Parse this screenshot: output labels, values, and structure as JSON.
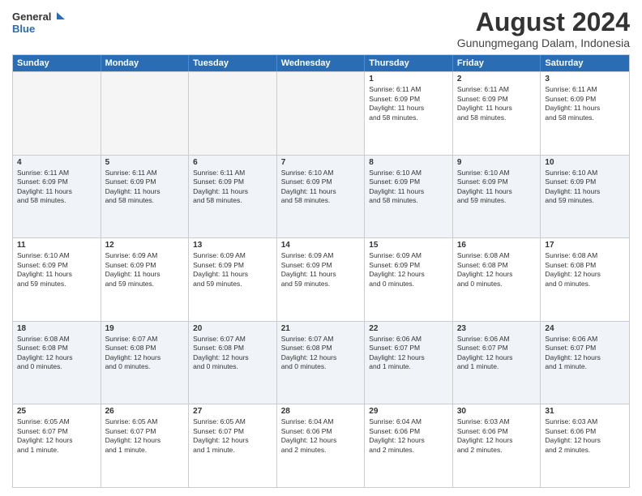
{
  "logo": {
    "line1": "General",
    "line2": "Blue"
  },
  "title": "August 2024",
  "subtitle": "Gunungmegang Dalam, Indonesia",
  "header_days": [
    "Sunday",
    "Monday",
    "Tuesday",
    "Wednesday",
    "Thursday",
    "Friday",
    "Saturday"
  ],
  "rows": [
    [
      {
        "day": "",
        "info": "",
        "empty": true
      },
      {
        "day": "",
        "info": "",
        "empty": true
      },
      {
        "day": "",
        "info": "",
        "empty": true
      },
      {
        "day": "",
        "info": "",
        "empty": true
      },
      {
        "day": "1",
        "info": "Sunrise: 6:11 AM\nSunset: 6:09 PM\nDaylight: 11 hours\nand 58 minutes.",
        "empty": false
      },
      {
        "day": "2",
        "info": "Sunrise: 6:11 AM\nSunset: 6:09 PM\nDaylight: 11 hours\nand 58 minutes.",
        "empty": false
      },
      {
        "day": "3",
        "info": "Sunrise: 6:11 AM\nSunset: 6:09 PM\nDaylight: 11 hours\nand 58 minutes.",
        "empty": false
      }
    ],
    [
      {
        "day": "4",
        "info": "Sunrise: 6:11 AM\nSunset: 6:09 PM\nDaylight: 11 hours\nand 58 minutes.",
        "empty": false
      },
      {
        "day": "5",
        "info": "Sunrise: 6:11 AM\nSunset: 6:09 PM\nDaylight: 11 hours\nand 58 minutes.",
        "empty": false
      },
      {
        "day": "6",
        "info": "Sunrise: 6:11 AM\nSunset: 6:09 PM\nDaylight: 11 hours\nand 58 minutes.",
        "empty": false
      },
      {
        "day": "7",
        "info": "Sunrise: 6:10 AM\nSunset: 6:09 PM\nDaylight: 11 hours\nand 58 minutes.",
        "empty": false
      },
      {
        "day": "8",
        "info": "Sunrise: 6:10 AM\nSunset: 6:09 PM\nDaylight: 11 hours\nand 58 minutes.",
        "empty": false
      },
      {
        "day": "9",
        "info": "Sunrise: 6:10 AM\nSunset: 6:09 PM\nDaylight: 11 hours\nand 59 minutes.",
        "empty": false
      },
      {
        "day": "10",
        "info": "Sunrise: 6:10 AM\nSunset: 6:09 PM\nDaylight: 11 hours\nand 59 minutes.",
        "empty": false
      }
    ],
    [
      {
        "day": "11",
        "info": "Sunrise: 6:10 AM\nSunset: 6:09 PM\nDaylight: 11 hours\nand 59 minutes.",
        "empty": false
      },
      {
        "day": "12",
        "info": "Sunrise: 6:09 AM\nSunset: 6:09 PM\nDaylight: 11 hours\nand 59 minutes.",
        "empty": false
      },
      {
        "day": "13",
        "info": "Sunrise: 6:09 AM\nSunset: 6:09 PM\nDaylight: 11 hours\nand 59 minutes.",
        "empty": false
      },
      {
        "day": "14",
        "info": "Sunrise: 6:09 AM\nSunset: 6:09 PM\nDaylight: 11 hours\nand 59 minutes.",
        "empty": false
      },
      {
        "day": "15",
        "info": "Sunrise: 6:09 AM\nSunset: 6:09 PM\nDaylight: 12 hours\nand 0 minutes.",
        "empty": false
      },
      {
        "day": "16",
        "info": "Sunrise: 6:08 AM\nSunset: 6:08 PM\nDaylight: 12 hours\nand 0 minutes.",
        "empty": false
      },
      {
        "day": "17",
        "info": "Sunrise: 6:08 AM\nSunset: 6:08 PM\nDaylight: 12 hours\nand 0 minutes.",
        "empty": false
      }
    ],
    [
      {
        "day": "18",
        "info": "Sunrise: 6:08 AM\nSunset: 6:08 PM\nDaylight: 12 hours\nand 0 minutes.",
        "empty": false
      },
      {
        "day": "19",
        "info": "Sunrise: 6:07 AM\nSunset: 6:08 PM\nDaylight: 12 hours\nand 0 minutes.",
        "empty": false
      },
      {
        "day": "20",
        "info": "Sunrise: 6:07 AM\nSunset: 6:08 PM\nDaylight: 12 hours\nand 0 minutes.",
        "empty": false
      },
      {
        "day": "21",
        "info": "Sunrise: 6:07 AM\nSunset: 6:08 PM\nDaylight: 12 hours\nand 0 minutes.",
        "empty": false
      },
      {
        "day": "22",
        "info": "Sunrise: 6:06 AM\nSunset: 6:07 PM\nDaylight: 12 hours\nand 1 minute.",
        "empty": false
      },
      {
        "day": "23",
        "info": "Sunrise: 6:06 AM\nSunset: 6:07 PM\nDaylight: 12 hours\nand 1 minute.",
        "empty": false
      },
      {
        "day": "24",
        "info": "Sunrise: 6:06 AM\nSunset: 6:07 PM\nDaylight: 12 hours\nand 1 minute.",
        "empty": false
      }
    ],
    [
      {
        "day": "25",
        "info": "Sunrise: 6:05 AM\nSunset: 6:07 PM\nDaylight: 12 hours\nand 1 minute.",
        "empty": false
      },
      {
        "day": "26",
        "info": "Sunrise: 6:05 AM\nSunset: 6:07 PM\nDaylight: 12 hours\nand 1 minute.",
        "empty": false
      },
      {
        "day": "27",
        "info": "Sunrise: 6:05 AM\nSunset: 6:07 PM\nDaylight: 12 hours\nand 1 minute.",
        "empty": false
      },
      {
        "day": "28",
        "info": "Sunrise: 6:04 AM\nSunset: 6:06 PM\nDaylight: 12 hours\nand 2 minutes.",
        "empty": false
      },
      {
        "day": "29",
        "info": "Sunrise: 6:04 AM\nSunset: 6:06 PM\nDaylight: 12 hours\nand 2 minutes.",
        "empty": false
      },
      {
        "day": "30",
        "info": "Sunrise: 6:03 AM\nSunset: 6:06 PM\nDaylight: 12 hours\nand 2 minutes.",
        "empty": false
      },
      {
        "day": "31",
        "info": "Sunrise: 6:03 AM\nSunset: 6:06 PM\nDaylight: 12 hours\nand 2 minutes.",
        "empty": false
      }
    ]
  ]
}
